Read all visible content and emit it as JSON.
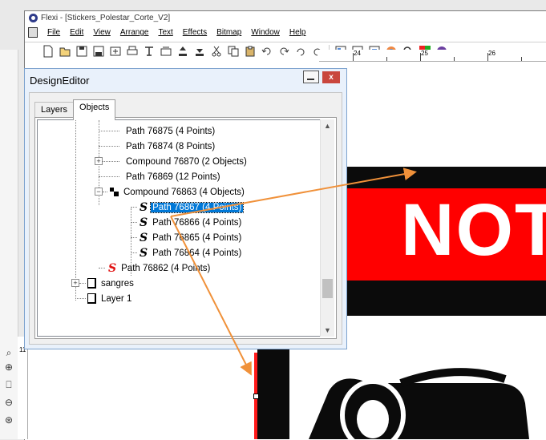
{
  "window": {
    "title": "Flexi - [Stickers_Polestar_Corte_V2]"
  },
  "menu": [
    "File",
    "Edit",
    "View",
    "Arrange",
    "Text",
    "Effects",
    "Bitmap",
    "Window",
    "Help"
  ],
  "ruler": {
    "top_labels": [
      "24",
      "25",
      "26"
    ],
    "left_label": "11"
  },
  "artwork": {
    "banner_text": "NOT"
  },
  "design_editor": {
    "title": "DesignEditor",
    "close_label": "x",
    "tabs": [
      "Layers",
      "Objects"
    ],
    "active_tab": "Objects",
    "tree": [
      {
        "label": "Path 76875 (4 Points)"
      },
      {
        "label": "Path 76874 (8 Points)"
      },
      {
        "label": "Compound 76870 (2 Objects)"
      },
      {
        "label": "Path 76869 (12 Points)"
      },
      {
        "label": "Compound 76863 (4 Objects)"
      },
      {
        "label": "Path 76867 (4 Points)"
      },
      {
        "label": "Path 76866 (4 Points)"
      },
      {
        "label": "Path 76865 (4 Points)"
      },
      {
        "label": "Path 76864 (4 Points)"
      },
      {
        "label": "Path 76862 (4 Points)"
      },
      {
        "label": "sangres"
      },
      {
        "label": "Layer 1"
      }
    ]
  },
  "colors": {
    "accent_selection": "#0078d7",
    "arrow": "#f0913a",
    "banner_red": "#ff0000",
    "path_icon_red": "#e01010"
  }
}
